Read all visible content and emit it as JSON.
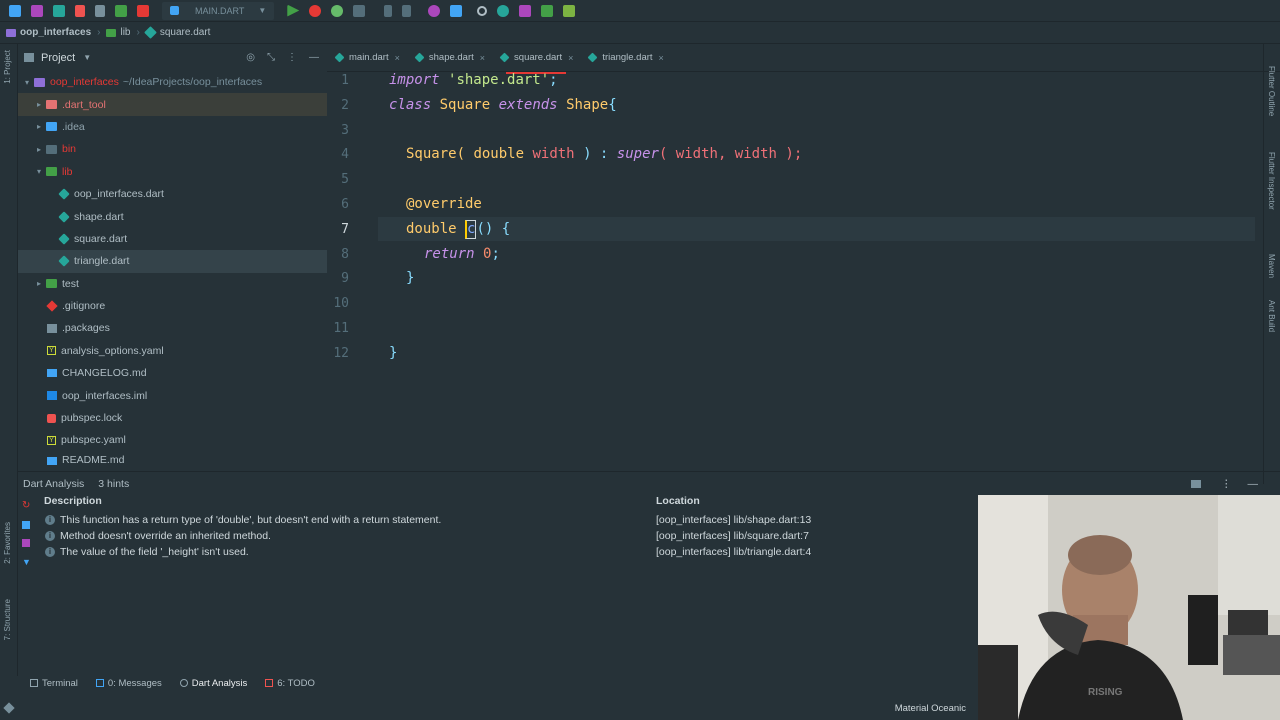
{
  "toolbar": {
    "run_config": "MAIN.DART",
    "icons": [
      "open-icon",
      "save-icon",
      "sync-icon",
      "back-icon",
      "forward-icon",
      "build-icon",
      "hammer-icon",
      "flutter-icon",
      "run-icon",
      "debug-icon",
      "profile-icon",
      "stop-icon",
      "attach-icon",
      "download-icon",
      "settings-icon",
      "structure-icon",
      "search-icon",
      "hot-reload-icon",
      "grid-icon",
      "plugin-icon"
    ]
  },
  "breadcrumb": {
    "project": "oop_interfaces",
    "folder": "lib",
    "file": "square.dart"
  },
  "left_strip": {
    "project_label": "1: Project",
    "favorites_label": "2: Favorites",
    "structure_label": "7: Structure"
  },
  "project_panel": {
    "title": "Project",
    "root_name": "oop_interfaces",
    "root_path": "~/IdeaProjects/oop_interfaces",
    "items": [
      {
        "name": ".dart_tool",
        "color": "#e57373"
      },
      {
        "name": ".idea",
        "color": "#90a4ae"
      },
      {
        "name": "bin",
        "color": "#e53935"
      },
      {
        "name": "lib",
        "color": "#e53935"
      },
      {
        "name": "oop_interfaces.dart",
        "color": "#b0bec5"
      },
      {
        "name": "shape.dart",
        "color": "#b0bec5"
      },
      {
        "name": "square.dart",
        "color": "#b0bec5"
      },
      {
        "name": "triangle.dart",
        "color": "#b0bec5"
      },
      {
        "name": "test",
        "color": "#b0bec5"
      },
      {
        "name": ".gitignore",
        "color": "#b0bec5"
      },
      {
        "name": ".packages",
        "color": "#b0bec5"
      },
      {
        "name": "analysis_options.yaml",
        "color": "#b0bec5"
      },
      {
        "name": "CHANGELOG.md",
        "color": "#b0bec5"
      },
      {
        "name": "oop_interfaces.iml",
        "color": "#b0bec5"
      },
      {
        "name": "pubspec.lock",
        "color": "#b0bec5"
      },
      {
        "name": "pubspec.yaml",
        "color": "#b0bec5"
      },
      {
        "name": "README.md",
        "color": "#b0bec5"
      }
    ]
  },
  "editor": {
    "tabs": [
      {
        "label": "main.dart",
        "close": "×"
      },
      {
        "label": "shape.dart",
        "close": "×"
      },
      {
        "label": "square.dart",
        "close": "×"
      },
      {
        "label": "triangle.dart",
        "close": "×"
      }
    ],
    "line_numbers": [
      "1",
      "2",
      "3",
      "4",
      "5",
      "6",
      "7",
      "8",
      "9",
      "10",
      "11",
      "12"
    ],
    "code": {
      "l1_kw": "import",
      "l1_str": "'shape.dart'",
      "l1_end": ";",
      "l2_kw": "class",
      "l2_name": "Square",
      "l2_kw2": "extends",
      "l2_parent": "Shape",
      "l2_brace": "{",
      "l4_ctor": "Square(",
      "l4_type": "double",
      "l4_param": "width",
      "l4_mid": ") :",
      "l4_super": "super",
      "l4_args": "( width, width );",
      "l6_ann": "@override",
      "l7_type": "double",
      "l7_caret": "c",
      "l7_rest": "() {",
      "l8_kw": "return",
      "l8_num": "0",
      "l8_end": ";",
      "l9_close": "}",
      "l12_close": "}"
    }
  },
  "right_strip": {
    "flutter_outline": "Flutter Outline",
    "flutter_inspector": "Flutter Inspector",
    "maven": "Maven",
    "ant_build": "Ant Build"
  },
  "analysis": {
    "title": "Dart Analysis",
    "hint_count": "3 hints",
    "col_description": "Description",
    "col_location": "Location",
    "rows": [
      {
        "description": "This function has a return type of 'double', but doesn't end with a return statement.",
        "location": "[oop_interfaces] lib/shape.dart:13"
      },
      {
        "description": "Method doesn't override an inherited method.",
        "location": "[oop_interfaces] lib/square.dart:7"
      },
      {
        "description": "The value of the field '_height' isn't used.",
        "location": "[oop_interfaces] lib/triangle.dart:4"
      }
    ]
  },
  "bottom_tabs": [
    {
      "label": "Terminal"
    },
    {
      "label": "0: Messages"
    },
    {
      "label": "Dart Analysis"
    },
    {
      "label": "6: TODO"
    }
  ],
  "statusbar": {
    "theme": "Material Oceanic"
  }
}
